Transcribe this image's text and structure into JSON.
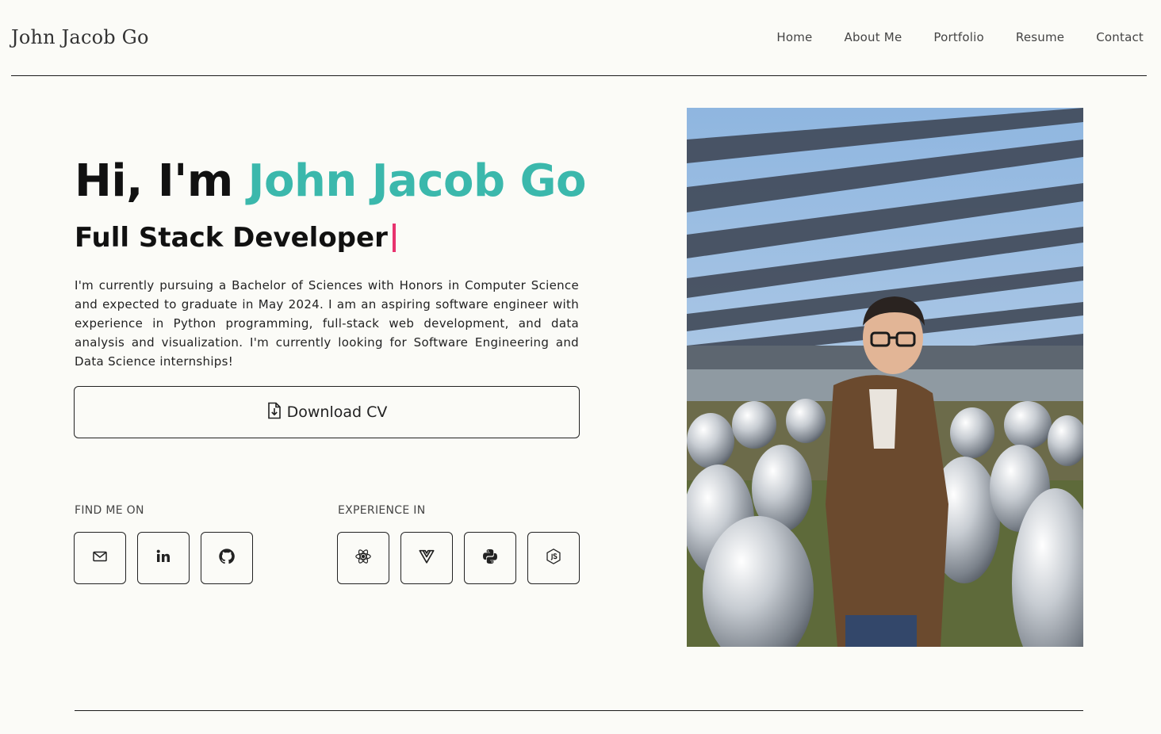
{
  "header": {
    "brand": "John Jacob Go",
    "nav": [
      "Home",
      "About Me",
      "Portfolio",
      "Resume",
      "Contact"
    ]
  },
  "hero": {
    "greeting": "Hi, I'm ",
    "name": "John Jacob Go",
    "role": "Full Stack Developer",
    "bio": "I'm currently pursuing a Bachelor of Sciences with Honors in Computer Science and expected to graduate in May 2024. I am an aspiring software engineer with experience in Python programming, full-stack web development, and data analysis and visualization. I'm currently looking for Software Engineering and Data Science internships!",
    "cv_label": "Download CV"
  },
  "find_me": {
    "label": "FIND ME ON",
    "icons": [
      "mail-icon",
      "linkedin-icon",
      "github-icon"
    ]
  },
  "experience": {
    "label": "EXPERIENCE IN",
    "icons": [
      "react-icon",
      "vue-icon",
      "python-icon",
      "nodejs-icon"
    ]
  },
  "colors": {
    "accent": "#3bb8ac",
    "cursor": "#e8326e",
    "background": "#fbfbf7"
  }
}
